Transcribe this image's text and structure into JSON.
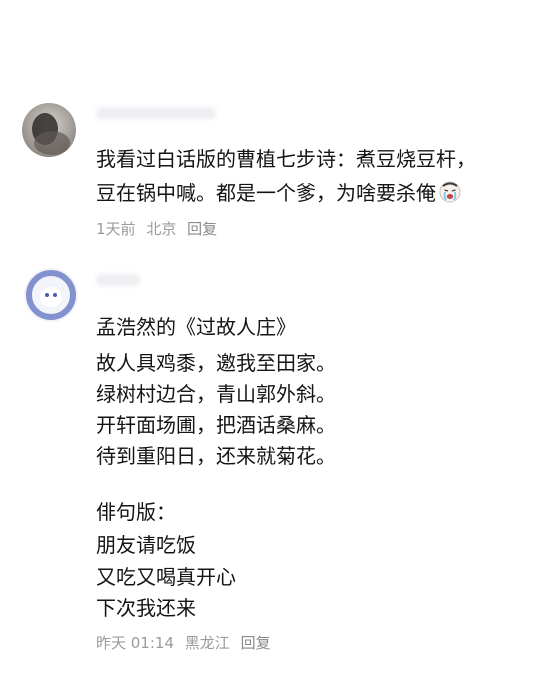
{
  "comments": [
    {
      "lines": [
        "我看过白话版的曹植七步诗：煮豆烧豆杆，",
        "豆在锅中喊。都是一个爹，为啥要杀俺"
      ],
      "emoji_icon": "crying-face-icon",
      "meta": {
        "time": "1天前",
        "location": "北京",
        "reply_label": "回复"
      }
    },
    {
      "title": "孟浩然的《过故人庄》",
      "poem": [
        "故人具鸡黍，邀我至田家。",
        "绿树村边合，青山郭外斜。",
        "开轩面场圃，把酒话桑麻。",
        "待到重阳日，还来就菊花。"
      ],
      "haiku_title": "俳句版：",
      "haiku": [
        "朋友请吃饭",
        "又吃又喝真开心",
        "下次我还来"
      ],
      "meta": {
        "time": "昨天 01:14",
        "location": "黑龙江",
        "reply_label": "回复"
      }
    }
  ],
  "colors": {
    "text": "#151515",
    "meta": "#9b9b9b",
    "background": "#ffffff"
  }
}
